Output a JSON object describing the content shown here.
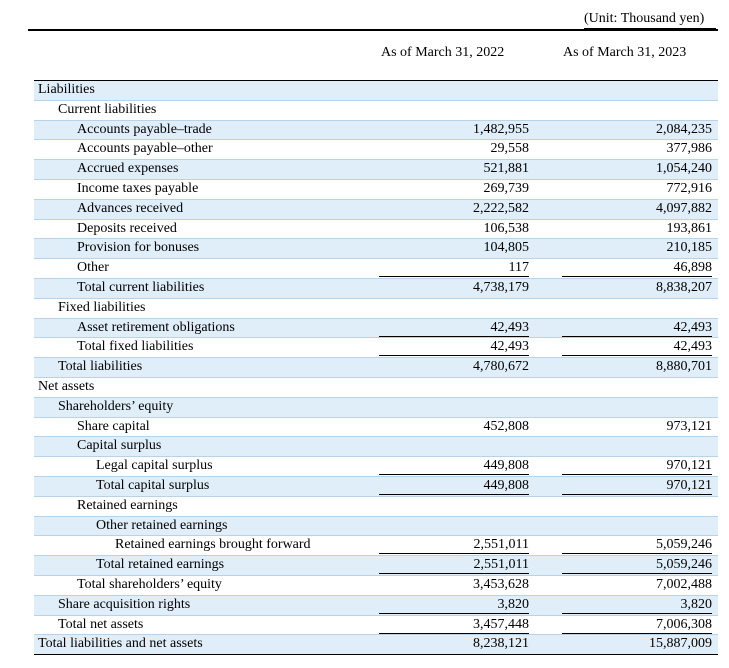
{
  "unit_note": "(Unit: Thousand yen)",
  "columns": [
    "As of March 31, 2022",
    "As of March 31, 2023"
  ],
  "rows": [
    {
      "label": "Liabilities",
      "level": 0,
      "v2022": "",
      "v2023": ""
    },
    {
      "label": "Current liabilities",
      "level": 1,
      "v2022": "",
      "v2023": ""
    },
    {
      "label": "Accounts payable–trade",
      "level": 2,
      "v2022": "1,482,955",
      "v2023": "2,084,235"
    },
    {
      "label": "Accounts payable–other",
      "level": 2,
      "v2022": "29,558",
      "v2023": "377,986"
    },
    {
      "label": "Accrued expenses",
      "level": 2,
      "v2022": "521,881",
      "v2023": "1,054,240"
    },
    {
      "label": "Income taxes payable",
      "level": 2,
      "v2022": "269,739",
      "v2023": "772,916"
    },
    {
      "label": "Advances received",
      "level": 2,
      "v2022": "2,222,582",
      "v2023": "4,097,882"
    },
    {
      "label": "Deposits received",
      "level": 2,
      "v2022": "106,538",
      "v2023": "193,861"
    },
    {
      "label": "Provision for bonuses",
      "level": 2,
      "v2022": "104,805",
      "v2023": "210,185"
    },
    {
      "label": "Other",
      "level": 2,
      "v2022": "117",
      "v2023": "46,898",
      "underline": true
    },
    {
      "label": "Total current liabilities",
      "level": 2,
      "v2022": "4,738,179",
      "v2023": "8,838,207"
    },
    {
      "label": "Fixed liabilities",
      "level": 1,
      "v2022": "",
      "v2023": ""
    },
    {
      "label": "Asset retirement obligations",
      "level": 2,
      "v2022": "42,493",
      "v2023": "42,493",
      "underline": true
    },
    {
      "label": "Total fixed liabilities",
      "level": 2,
      "v2022": "42,493",
      "v2023": "42,493",
      "underline": true
    },
    {
      "label": "Total liabilities",
      "level": 1,
      "v2022": "4,780,672",
      "v2023": "8,880,701"
    },
    {
      "label": "Net assets",
      "level": 0,
      "v2022": "",
      "v2023": ""
    },
    {
      "label": "Shareholders’ equity",
      "level": 1,
      "v2022": "",
      "v2023": ""
    },
    {
      "label": "Share capital",
      "level": 2,
      "v2022": "452,808",
      "v2023": "973,121"
    },
    {
      "label": "Capital surplus",
      "level": 2,
      "v2022": "",
      "v2023": ""
    },
    {
      "label": "Legal capital surplus",
      "level": 3,
      "v2022": "449,808",
      "v2023": "970,121",
      "underline": true
    },
    {
      "label": "Total capital surplus",
      "level": 3,
      "v2022": "449,808",
      "v2023": "970,121",
      "underline": true
    },
    {
      "label": "Retained earnings",
      "level": 2,
      "v2022": "",
      "v2023": ""
    },
    {
      "label": "Other retained earnings",
      "level": 3,
      "v2022": "",
      "v2023": ""
    },
    {
      "label": "Retained earnings brought forward",
      "level": 4,
      "v2022": "2,551,011",
      "v2023": "5,059,246",
      "underline": true
    },
    {
      "label": "Total retained earnings",
      "level": 3,
      "v2022": "2,551,011",
      "v2023": "5,059,246",
      "underline": true
    },
    {
      "label": "Total shareholders’ equity",
      "level": 2,
      "v2022": "3,453,628",
      "v2023": "7,002,488"
    },
    {
      "label": "Share acquisition rights",
      "level": 1,
      "v2022": "3,820",
      "v2023": "3,820",
      "underline": true
    },
    {
      "label": "Total net assets",
      "level": 1,
      "v2022": "3,457,448",
      "v2023": "7,006,308",
      "underline": true
    },
    {
      "label": "Total liabilities and net assets",
      "level": 0,
      "v2022": "8,238,121",
      "v2023": "15,887,009"
    }
  ]
}
